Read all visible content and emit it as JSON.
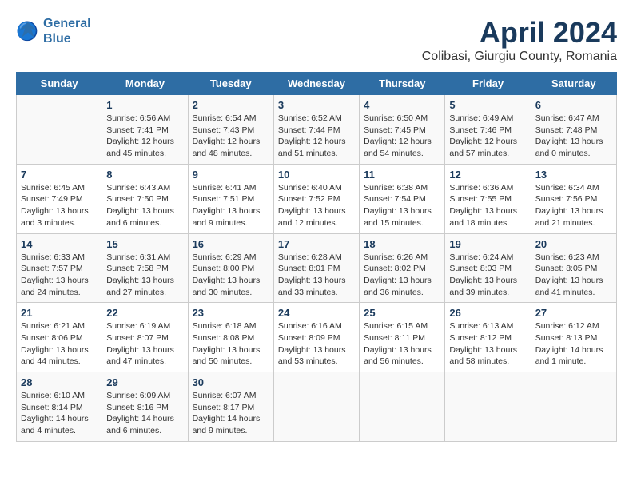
{
  "header": {
    "logo_line1": "General",
    "logo_line2": "Blue",
    "title": "April 2024",
    "subtitle": "Colibasi, Giurgiu County, Romania"
  },
  "calendar": {
    "days_of_week": [
      "Sunday",
      "Monday",
      "Tuesday",
      "Wednesday",
      "Thursday",
      "Friday",
      "Saturday"
    ],
    "weeks": [
      [
        {
          "day": "",
          "info": ""
        },
        {
          "day": "1",
          "info": "Sunrise: 6:56 AM\nSunset: 7:41 PM\nDaylight: 12 hours\nand 45 minutes."
        },
        {
          "day": "2",
          "info": "Sunrise: 6:54 AM\nSunset: 7:43 PM\nDaylight: 12 hours\nand 48 minutes."
        },
        {
          "day": "3",
          "info": "Sunrise: 6:52 AM\nSunset: 7:44 PM\nDaylight: 12 hours\nand 51 minutes."
        },
        {
          "day": "4",
          "info": "Sunrise: 6:50 AM\nSunset: 7:45 PM\nDaylight: 12 hours\nand 54 minutes."
        },
        {
          "day": "5",
          "info": "Sunrise: 6:49 AM\nSunset: 7:46 PM\nDaylight: 12 hours\nand 57 minutes."
        },
        {
          "day": "6",
          "info": "Sunrise: 6:47 AM\nSunset: 7:48 PM\nDaylight: 13 hours\nand 0 minutes."
        }
      ],
      [
        {
          "day": "7",
          "info": "Sunrise: 6:45 AM\nSunset: 7:49 PM\nDaylight: 13 hours\nand 3 minutes."
        },
        {
          "day": "8",
          "info": "Sunrise: 6:43 AM\nSunset: 7:50 PM\nDaylight: 13 hours\nand 6 minutes."
        },
        {
          "day": "9",
          "info": "Sunrise: 6:41 AM\nSunset: 7:51 PM\nDaylight: 13 hours\nand 9 minutes."
        },
        {
          "day": "10",
          "info": "Sunrise: 6:40 AM\nSunset: 7:52 PM\nDaylight: 13 hours\nand 12 minutes."
        },
        {
          "day": "11",
          "info": "Sunrise: 6:38 AM\nSunset: 7:54 PM\nDaylight: 13 hours\nand 15 minutes."
        },
        {
          "day": "12",
          "info": "Sunrise: 6:36 AM\nSunset: 7:55 PM\nDaylight: 13 hours\nand 18 minutes."
        },
        {
          "day": "13",
          "info": "Sunrise: 6:34 AM\nSunset: 7:56 PM\nDaylight: 13 hours\nand 21 minutes."
        }
      ],
      [
        {
          "day": "14",
          "info": "Sunrise: 6:33 AM\nSunset: 7:57 PM\nDaylight: 13 hours\nand 24 minutes."
        },
        {
          "day": "15",
          "info": "Sunrise: 6:31 AM\nSunset: 7:58 PM\nDaylight: 13 hours\nand 27 minutes."
        },
        {
          "day": "16",
          "info": "Sunrise: 6:29 AM\nSunset: 8:00 PM\nDaylight: 13 hours\nand 30 minutes."
        },
        {
          "day": "17",
          "info": "Sunrise: 6:28 AM\nSunset: 8:01 PM\nDaylight: 13 hours\nand 33 minutes."
        },
        {
          "day": "18",
          "info": "Sunrise: 6:26 AM\nSunset: 8:02 PM\nDaylight: 13 hours\nand 36 minutes."
        },
        {
          "day": "19",
          "info": "Sunrise: 6:24 AM\nSunset: 8:03 PM\nDaylight: 13 hours\nand 39 minutes."
        },
        {
          "day": "20",
          "info": "Sunrise: 6:23 AM\nSunset: 8:05 PM\nDaylight: 13 hours\nand 41 minutes."
        }
      ],
      [
        {
          "day": "21",
          "info": "Sunrise: 6:21 AM\nSunset: 8:06 PM\nDaylight: 13 hours\nand 44 minutes."
        },
        {
          "day": "22",
          "info": "Sunrise: 6:19 AM\nSunset: 8:07 PM\nDaylight: 13 hours\nand 47 minutes."
        },
        {
          "day": "23",
          "info": "Sunrise: 6:18 AM\nSunset: 8:08 PM\nDaylight: 13 hours\nand 50 minutes."
        },
        {
          "day": "24",
          "info": "Sunrise: 6:16 AM\nSunset: 8:09 PM\nDaylight: 13 hours\nand 53 minutes."
        },
        {
          "day": "25",
          "info": "Sunrise: 6:15 AM\nSunset: 8:11 PM\nDaylight: 13 hours\nand 56 minutes."
        },
        {
          "day": "26",
          "info": "Sunrise: 6:13 AM\nSunset: 8:12 PM\nDaylight: 13 hours\nand 58 minutes."
        },
        {
          "day": "27",
          "info": "Sunrise: 6:12 AM\nSunset: 8:13 PM\nDaylight: 14 hours\nand 1 minute."
        }
      ],
      [
        {
          "day": "28",
          "info": "Sunrise: 6:10 AM\nSunset: 8:14 PM\nDaylight: 14 hours\nand 4 minutes."
        },
        {
          "day": "29",
          "info": "Sunrise: 6:09 AM\nSunset: 8:16 PM\nDaylight: 14 hours\nand 6 minutes."
        },
        {
          "day": "30",
          "info": "Sunrise: 6:07 AM\nSunset: 8:17 PM\nDaylight: 14 hours\nand 9 minutes."
        },
        {
          "day": "",
          "info": ""
        },
        {
          "day": "",
          "info": ""
        },
        {
          "day": "",
          "info": ""
        },
        {
          "day": "",
          "info": ""
        }
      ]
    ]
  }
}
